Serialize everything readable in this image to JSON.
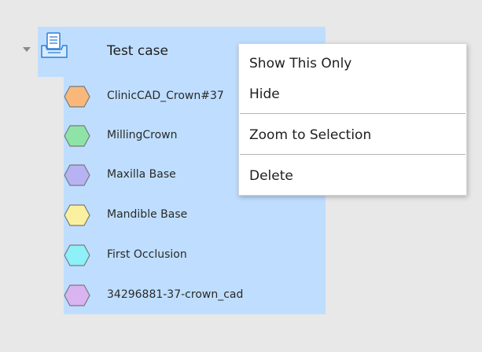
{
  "tree": {
    "root": {
      "label": "Test case",
      "icon": "case-tray-icon",
      "expanded": true
    },
    "items": [
      {
        "label": "ClinicCAD_Crown#37",
        "icon": "hexagon-icon",
        "color": "#f9b87a"
      },
      {
        "label": "MillingCrown",
        "icon": "hexagon-icon",
        "color": "#8ee4a6"
      },
      {
        "label": "Maxilla Base",
        "icon": "hexagon-icon",
        "color": "#b6b2f3"
      },
      {
        "label": "Mandible Base",
        "icon": "hexagon-icon",
        "color": "#fbf0a0"
      },
      {
        "label": "First Occlusion",
        "icon": "hexagon-icon",
        "color": "#8ef0f8"
      },
      {
        "label": "34296881-37-crown_cad",
        "icon": "hexagon-icon",
        "color": "#d9b4f1"
      }
    ],
    "selection_color": "#bfdeff"
  },
  "context_menu": {
    "items": [
      {
        "label": "Show This Only"
      },
      {
        "label": "Hide"
      },
      {
        "label": "Zoom to Selection"
      },
      {
        "label": "Delete"
      }
    ]
  }
}
